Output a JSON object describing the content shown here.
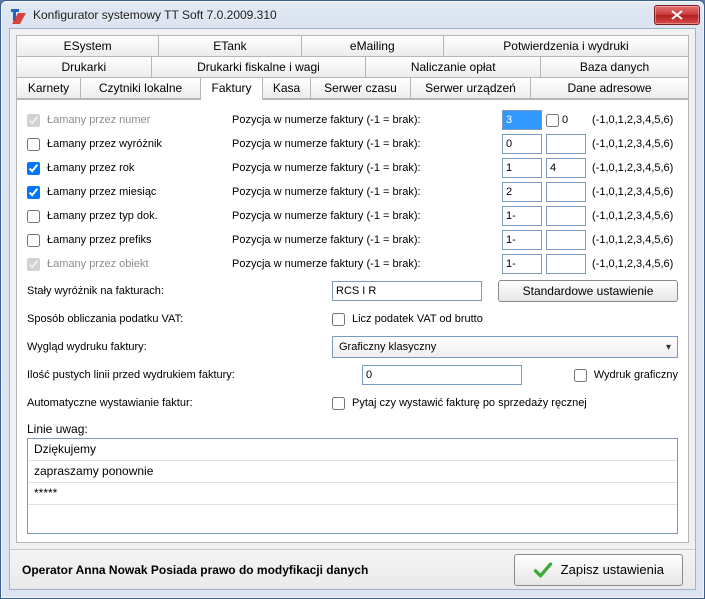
{
  "window": {
    "title": "Konfigurator systemowy TT Soft 7.0.2009.310"
  },
  "tabs": {
    "row1": [
      "ESystem",
      "ETank",
      "eMailing",
      "Potwierdzenia i wydruki"
    ],
    "row2": [
      "Drukarki",
      "Drukarki fiskalne i wagi",
      "Naliczanie opłat",
      "Baza danych"
    ],
    "row3": [
      "Karnety",
      "Czytniki lokalne",
      "Faktury",
      "Kasa",
      "Serwer czasu",
      "Serwer urządzeń",
      "Dane adresowe"
    ]
  },
  "rows": [
    {
      "chk": true,
      "disabled": true,
      "label": "Łamany przez numer",
      "pos": "Pozycja w numerze faktury (-1 = brak):",
      "v1": "3",
      "v2": "0",
      "sel": true,
      "cb2": false,
      "hint": "(-1,0,1,2,3,4,5,6)"
    },
    {
      "chk": false,
      "disabled": false,
      "label": "Łamany przez wyróżnik",
      "pos": "Pozycja w numerze faktury (-1 = brak):",
      "v1": "0",
      "v2": "",
      "hint": "(-1,0,1,2,3,4,5,6)"
    },
    {
      "chk": true,
      "disabled": false,
      "label": "Łamany przez rok",
      "pos": "Pozycja w numerze faktury (-1 = brak):",
      "v1": "1",
      "v2": "4",
      "hint": "(-1,0,1,2,3,4,5,6)"
    },
    {
      "chk": true,
      "disabled": false,
      "label": "Łamany przez miesiąc",
      "pos": "Pozycja w numerze faktury (-1 = brak):",
      "v1": "2",
      "v2": "",
      "hint": "(-1,0,1,2,3,4,5,6)"
    },
    {
      "chk": false,
      "disabled": false,
      "label": "Łamany przez typ dok.",
      "pos": "Pozycja w numerze faktury (-1 = brak):",
      "v1": "1-",
      "v2": "",
      "hint": "(-1,0,1,2,3,4,5,6)"
    },
    {
      "chk": false,
      "disabled": false,
      "label": "Łamany przez prefiks",
      "pos": "Pozycja w numerze faktury (-1 = brak):",
      "v1": "1-",
      "v2": "",
      "hint": "(-1,0,1,2,3,4,5,6)"
    },
    {
      "chk": true,
      "disabled": true,
      "label": "Łamany przez obiekt",
      "pos": "Pozycja w numerze faktury (-1 = brak):",
      "v1": "1-",
      "v2": "",
      "hint": "(-1,0,1,2,3,4,5,6)"
    }
  ],
  "staly": {
    "label": "Stały wyróżnik na fakturach:",
    "value": "RCS I R",
    "btn": "Standardowe ustawienie"
  },
  "vat": {
    "label": "Sposób obliczania podatku VAT:",
    "cb": false,
    "cb_label": "Licz podatek VAT od brutto"
  },
  "wyglad": {
    "label": "Wygląd wydruku faktury:",
    "value": "Graficzny klasyczny"
  },
  "ilosc": {
    "label": "Ilość pustych linii przed wydrukiem faktury:",
    "value": "0",
    "cb": false,
    "cb_label": "Wydruk graficzny"
  },
  "auto": {
    "label": "Automatyczne wystawianie faktur:",
    "cb": false,
    "cb_label": "Pytaj czy wystawić fakturę po sprzedaży ręcznej"
  },
  "linie": {
    "label": "Linie uwag:",
    "lines": [
      "Dziękujemy",
      "zapraszamy ponownie",
      "*****"
    ]
  },
  "footer": {
    "status": "Operator Anna Nowak Posiada prawo do modyfikacji danych",
    "save": "Zapisz ustawienia"
  }
}
